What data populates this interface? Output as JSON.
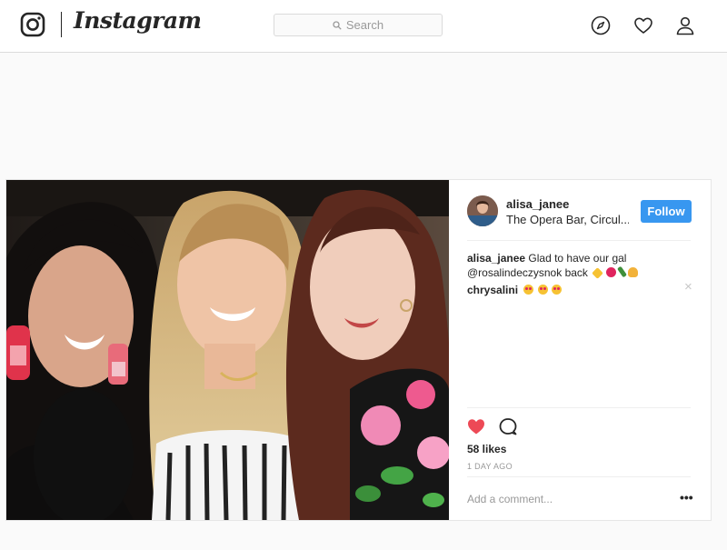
{
  "header": {
    "wordmark": "Instagram",
    "search_placeholder": "Search",
    "icons": [
      "instagram-glyph-icon",
      "search-icon",
      "compass-icon",
      "heart-icon",
      "user-icon"
    ]
  },
  "post": {
    "username": "alisa_janee",
    "location": "The Opera Bar, Circul...",
    "follow_label": "Follow",
    "caption": {
      "author": "alisa_janee",
      "text": "Glad to have our gal",
      "mention": "@rosalindeczysnok",
      "suffix": "back",
      "emojis": [
        "sparkles",
        "red-heart",
        "champagne",
        "praying-hands"
      ]
    },
    "comments": [
      {
        "author": "chrysalini",
        "emojis": [
          "heart-eyes",
          "heart-eyes",
          "heart-eyes"
        ]
      }
    ],
    "liked": true,
    "likes": "58 likes",
    "age": "1 DAY AGO",
    "add_comment_placeholder": "Add a comment...",
    "more_label": "•••",
    "close_label": "×"
  },
  "colors": {
    "accent": "#3897f0",
    "like_red": "#ed4956",
    "border": "#dbdbdb",
    "muted_text": "#999999"
  }
}
